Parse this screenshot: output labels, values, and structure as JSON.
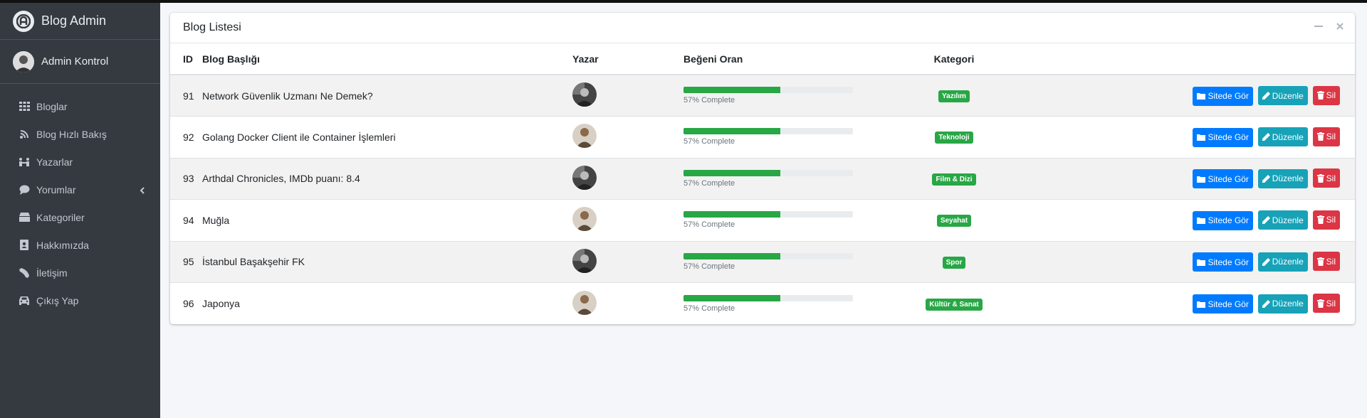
{
  "sidebar": {
    "brand": "Blog Admin",
    "user": "Admin Kontrol",
    "items": [
      {
        "label": "Bloglar",
        "icon": "grid-icon"
      },
      {
        "label": "Blog Hızlı Bakış",
        "icon": "blog-icon"
      },
      {
        "label": "Yazarlar",
        "icon": "users-icon"
      },
      {
        "label": "Yorumlar",
        "icon": "comment-icon"
      },
      {
        "label": "Kategoriler",
        "icon": "box-icon"
      },
      {
        "label": "Hakkımızda",
        "icon": "address-book-icon"
      },
      {
        "label": "İletişim",
        "icon": "phone-icon"
      },
      {
        "label": "Çıkış Yap",
        "icon": "car-icon"
      }
    ]
  },
  "card": {
    "title": "Blog Listesi"
  },
  "table": {
    "headers": [
      "ID",
      "Blog Başlığı",
      "Yazar",
      "Beğeni Oran",
      "Kategori"
    ],
    "buttons": {
      "view": "Sitede Gör",
      "edit": "Düzenle",
      "delete": "Sil"
    },
    "rows": [
      {
        "id": "91",
        "title": "Network Güvenlik Uzmanı Ne Demek?",
        "progress": 0.57,
        "progress_text": "57% Complete",
        "category": "Yazılım"
      },
      {
        "id": "92",
        "title": "Golang Docker Client ile Container İşlemleri",
        "progress": 0.57,
        "progress_text": "57% Complete",
        "category": "Teknoloji"
      },
      {
        "id": "93",
        "title": "Arthdal Chronicles, IMDb puanı: 8.4",
        "progress": 0.57,
        "progress_text": "57% Complete",
        "category": "Film & Dizi"
      },
      {
        "id": "94",
        "title": "Muğla",
        "progress": 0.57,
        "progress_text": "57% Complete",
        "category": "Seyahat"
      },
      {
        "id": "95",
        "title": "İstanbul Başakşehir FK",
        "progress": 0.57,
        "progress_text": "57% Complete",
        "category": "Spor"
      },
      {
        "id": "96",
        "title": "Japonya",
        "progress": 0.57,
        "progress_text": "57% Complete",
        "category": "Kültür & Sanat"
      }
    ]
  },
  "colors": {
    "sidebar_bg": "#343a40",
    "progress": "#28a745",
    "btn_view": "#007bff",
    "btn_edit": "#17a2b8",
    "btn_delete": "#dc3545"
  }
}
